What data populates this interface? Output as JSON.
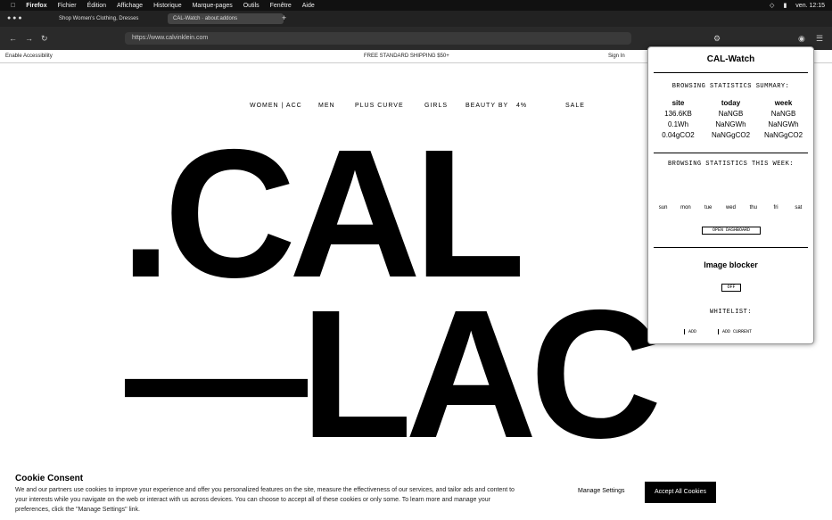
{
  "menubar": {
    "items": [
      "Firefox",
      "Fichier",
      "Édition",
      "Affichage",
      "Historique",
      "Marque-pages",
      "Outils",
      "Fenêtre",
      "Aide"
    ],
    "clock": "ven. 12:15"
  },
  "tabs": [
    {
      "label": "Shop Women's Clothing, Dresses",
      "active": false
    },
    {
      "label": "CAL-Watch · about:addons",
      "active": true
    }
  ],
  "urlbar": {
    "address": "https://www.calvinklein.com"
  },
  "promo": {
    "left": "Enable Accessibility",
    "center": "FREE STANDARD SHIPPING $50+",
    "right": "Sign In"
  },
  "nav": [
    "WOMEN | ACC",
    "MEN",
    "PLUS CURVE",
    "GIRLS",
    "BEAUTY BY",
    "4%",
    "SALE"
  ],
  "logo": {
    "line1": ".CAL",
    "line2": "—LAC"
  },
  "cookie": {
    "title": "Cookie Consent",
    "body": "We and our partners use cookies to improve your experience and offer you personalized features on the site, measure the effectiveness of our services, and tailor ads and content to your interests while you navigate on the web or interact with us across devices. You can choose to accept all of these cookies or only some. To learn more and manage your preferences, click the \"Manage Settings\" link.",
    "manage_label": "Manage Settings",
    "accept_label": "Accept All Cookies"
  },
  "panel": {
    "title": "CAL-Watch",
    "summary_heading": "BROWSING STATISTICS SUMMARY:",
    "columns": [
      "site",
      "today",
      "week"
    ],
    "rows": [
      [
        "136.6KB",
        "NaNGB",
        "NaNGB"
      ],
      [
        "0.1Wh",
        "NaNGWh",
        "NaNGWh"
      ],
      [
        "0.04gCO2",
        "NaNGgCO2",
        "NaNGgCO2"
      ]
    ],
    "week_heading": "BROWSING STATISTICS THIS WEEK:",
    "days": [
      "sun",
      "mon",
      "tue",
      "wed",
      "thu",
      "fri",
      "sat"
    ],
    "dashboard_label": "OPEN DASHBOARD",
    "blocker_title": "Image blocker",
    "blocker_toggle": "OFF",
    "whitelist_heading": "WHITELIST:",
    "whitelist_items": [
      "ADD",
      "ADD CURRENT"
    ]
  }
}
